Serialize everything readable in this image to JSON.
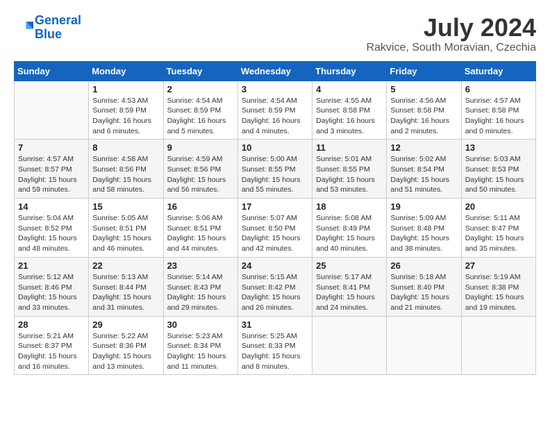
{
  "header": {
    "logo_line1": "General",
    "logo_line2": "Blue",
    "month_year": "July 2024",
    "location": "Rakvice, South Moravian, Czechia"
  },
  "days_of_week": [
    "Sunday",
    "Monday",
    "Tuesday",
    "Wednesday",
    "Thursday",
    "Friday",
    "Saturday"
  ],
  "weeks": [
    [
      {
        "day": "",
        "info": ""
      },
      {
        "day": "1",
        "info": "Sunrise: 4:53 AM\nSunset: 8:59 PM\nDaylight: 16 hours\nand 6 minutes."
      },
      {
        "day": "2",
        "info": "Sunrise: 4:54 AM\nSunset: 8:59 PM\nDaylight: 16 hours\nand 5 minutes."
      },
      {
        "day": "3",
        "info": "Sunrise: 4:54 AM\nSunset: 8:59 PM\nDaylight: 16 hours\nand 4 minutes."
      },
      {
        "day": "4",
        "info": "Sunrise: 4:55 AM\nSunset: 8:58 PM\nDaylight: 16 hours\nand 3 minutes."
      },
      {
        "day": "5",
        "info": "Sunrise: 4:56 AM\nSunset: 8:58 PM\nDaylight: 16 hours\nand 2 minutes."
      },
      {
        "day": "6",
        "info": "Sunrise: 4:57 AM\nSunset: 8:58 PM\nDaylight: 16 hours\nand 0 minutes."
      }
    ],
    [
      {
        "day": "7",
        "info": "Sunrise: 4:57 AM\nSunset: 8:57 PM\nDaylight: 15 hours\nand 59 minutes."
      },
      {
        "day": "8",
        "info": "Sunrise: 4:58 AM\nSunset: 8:56 PM\nDaylight: 15 hours\nand 58 minutes."
      },
      {
        "day": "9",
        "info": "Sunrise: 4:59 AM\nSunset: 8:56 PM\nDaylight: 15 hours\nand 56 minutes."
      },
      {
        "day": "10",
        "info": "Sunrise: 5:00 AM\nSunset: 8:55 PM\nDaylight: 15 hours\nand 55 minutes."
      },
      {
        "day": "11",
        "info": "Sunrise: 5:01 AM\nSunset: 8:55 PM\nDaylight: 15 hours\nand 53 minutes."
      },
      {
        "day": "12",
        "info": "Sunrise: 5:02 AM\nSunset: 8:54 PM\nDaylight: 15 hours\nand 51 minutes."
      },
      {
        "day": "13",
        "info": "Sunrise: 5:03 AM\nSunset: 8:53 PM\nDaylight: 15 hours\nand 50 minutes."
      }
    ],
    [
      {
        "day": "14",
        "info": "Sunrise: 5:04 AM\nSunset: 8:52 PM\nDaylight: 15 hours\nand 48 minutes."
      },
      {
        "day": "15",
        "info": "Sunrise: 5:05 AM\nSunset: 8:51 PM\nDaylight: 15 hours\nand 46 minutes."
      },
      {
        "day": "16",
        "info": "Sunrise: 5:06 AM\nSunset: 8:51 PM\nDaylight: 15 hours\nand 44 minutes."
      },
      {
        "day": "17",
        "info": "Sunrise: 5:07 AM\nSunset: 8:50 PM\nDaylight: 15 hours\nand 42 minutes."
      },
      {
        "day": "18",
        "info": "Sunrise: 5:08 AM\nSunset: 8:49 PM\nDaylight: 15 hours\nand 40 minutes."
      },
      {
        "day": "19",
        "info": "Sunrise: 5:09 AM\nSunset: 8:48 PM\nDaylight: 15 hours\nand 38 minutes."
      },
      {
        "day": "20",
        "info": "Sunrise: 5:11 AM\nSunset: 8:47 PM\nDaylight: 15 hours\nand 35 minutes."
      }
    ],
    [
      {
        "day": "21",
        "info": "Sunrise: 5:12 AM\nSunset: 8:46 PM\nDaylight: 15 hours\nand 33 minutes."
      },
      {
        "day": "22",
        "info": "Sunrise: 5:13 AM\nSunset: 8:44 PM\nDaylight: 15 hours\nand 31 minutes."
      },
      {
        "day": "23",
        "info": "Sunrise: 5:14 AM\nSunset: 8:43 PM\nDaylight: 15 hours\nand 29 minutes."
      },
      {
        "day": "24",
        "info": "Sunrise: 5:15 AM\nSunset: 8:42 PM\nDaylight: 15 hours\nand 26 minutes."
      },
      {
        "day": "25",
        "info": "Sunrise: 5:17 AM\nSunset: 8:41 PM\nDaylight: 15 hours\nand 24 minutes."
      },
      {
        "day": "26",
        "info": "Sunrise: 5:18 AM\nSunset: 8:40 PM\nDaylight: 15 hours\nand 21 minutes."
      },
      {
        "day": "27",
        "info": "Sunrise: 5:19 AM\nSunset: 8:38 PM\nDaylight: 15 hours\nand 19 minutes."
      }
    ],
    [
      {
        "day": "28",
        "info": "Sunrise: 5:21 AM\nSunset: 8:37 PM\nDaylight: 15 hours\nand 16 minutes."
      },
      {
        "day": "29",
        "info": "Sunrise: 5:22 AM\nSunset: 8:36 PM\nDaylight: 15 hours\nand 13 minutes."
      },
      {
        "day": "30",
        "info": "Sunrise: 5:23 AM\nSunset: 8:34 PM\nDaylight: 15 hours\nand 11 minutes."
      },
      {
        "day": "31",
        "info": "Sunrise: 5:25 AM\nSunset: 8:33 PM\nDaylight: 15 hours\nand 8 minutes."
      },
      {
        "day": "",
        "info": ""
      },
      {
        "day": "",
        "info": ""
      },
      {
        "day": "",
        "info": ""
      }
    ]
  ]
}
